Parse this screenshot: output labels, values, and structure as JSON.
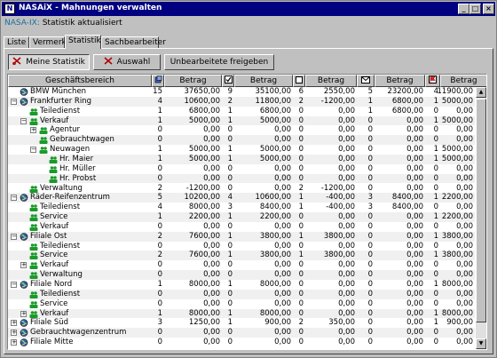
{
  "window": {
    "title": "NASAiX - Mahnungen verwalten",
    "app_icon": "nasaix-app-icon",
    "buttons": [
      "_",
      "□",
      "×"
    ]
  },
  "status": {
    "prefix": "NASA-IX:",
    "text": "Statistik aktualisiert"
  },
  "tabs": [
    "Liste",
    "Vermerk",
    "Statistik",
    "Sachbearbeiter"
  ],
  "active_tab": "Statistik",
  "toolbar": {
    "my_stats": "Meine Statistik",
    "selection": "Auswahl",
    "release": "Unbearbeitete freigeben"
  },
  "columns": {
    "area": "Geschäftsbereich",
    "amount": "Betrag",
    "icons": [
      "coins-icon",
      "checkbox-checked-icon",
      "checkbox-empty-icon",
      "envelope-icon",
      "red-flag-icon"
    ]
  },
  "rows": [
    {
      "label": "BMW München",
      "icon": "globe-icon",
      "level": 0,
      "exp": "",
      "v": [
        "15",
        "37650,00",
        "9",
        "35100,00",
        "6",
        "2550,00",
        "5",
        "23200,00",
        "4",
        "11900,00"
      ]
    },
    {
      "label": "Frankfurter Ring",
      "icon": "globe-icon",
      "level": 0,
      "exp": "−",
      "v": [
        "4",
        "10600,00",
        "2",
        "11800,00",
        "2",
        "-1200,00",
        "1",
        "6800,00",
        "1",
        "5000,00"
      ]
    },
    {
      "label": "Teiledienst",
      "icon": "people-icon",
      "level": 1,
      "exp": "",
      "v": [
        "1",
        "6800,00",
        "1",
        "6800,00",
        "0",
        "0,00",
        "1",
        "6800,00",
        "0",
        "0,00"
      ]
    },
    {
      "label": "Verkauf",
      "icon": "people-icon",
      "level": 1,
      "exp": "−",
      "v": [
        "1",
        "5000,00",
        "1",
        "5000,00",
        "0",
        "0,00",
        "0",
        "0,00",
        "1",
        "5000,00"
      ]
    },
    {
      "label": "Agentur",
      "icon": "people-icon",
      "level": 2,
      "exp": "+",
      "v": [
        "0",
        "0,00",
        "0",
        "0,00",
        "0",
        "0,00",
        "0",
        "0,00",
        "0",
        "0,00"
      ]
    },
    {
      "label": "Gebrauchtwagen",
      "icon": "people-icon",
      "level": 2,
      "exp": "",
      "v": [
        "0",
        "0,00",
        "0",
        "0,00",
        "0",
        "0,00",
        "0",
        "0,00",
        "0",
        "0,00"
      ]
    },
    {
      "label": "Neuwagen",
      "icon": "people-icon",
      "level": 2,
      "exp": "−",
      "v": [
        "1",
        "5000,00",
        "1",
        "5000,00",
        "0",
        "0,00",
        "0",
        "0,00",
        "1",
        "5000,00"
      ]
    },
    {
      "label": "Hr. Maier",
      "icon": "people-icon",
      "level": 3,
      "exp": "",
      "v": [
        "1",
        "5000,00",
        "1",
        "5000,00",
        "0",
        "0,00",
        "0",
        "0,00",
        "1",
        "5000,00"
      ]
    },
    {
      "label": "Hr. Müller",
      "icon": "people-icon",
      "level": 3,
      "exp": "",
      "v": [
        "0",
        "0,00",
        "0",
        "0,00",
        "0",
        "0,00",
        "0",
        "0,00",
        "0",
        "0,00"
      ]
    },
    {
      "label": "Hr. Probst",
      "icon": "people-icon",
      "level": 3,
      "exp": "",
      "v": [
        "0",
        "0,00",
        "0",
        "0,00",
        "0",
        "0,00",
        "0",
        "0,00",
        "0",
        "0,00"
      ]
    },
    {
      "label": "Verwaltung",
      "icon": "people-icon",
      "level": 1,
      "exp": "",
      "v": [
        "2",
        "-1200,00",
        "0",
        "0,00",
        "2",
        "-1200,00",
        "0",
        "0,00",
        "0",
        "0,00"
      ]
    },
    {
      "label": "Räder-Reifenzentrum",
      "icon": "globe-icon",
      "level": 0,
      "exp": "−",
      "v": [
        "5",
        "10200,00",
        "4",
        "10600,00",
        "1",
        "-400,00",
        "3",
        "8400,00",
        "1",
        "2200,00"
      ]
    },
    {
      "label": "Teiledienst",
      "icon": "people-icon",
      "level": 1,
      "exp": "",
      "v": [
        "4",
        "8000,00",
        "3",
        "8400,00",
        "1",
        "-400,00",
        "3",
        "8400,00",
        "0",
        "0,00"
      ]
    },
    {
      "label": "Service",
      "icon": "people-icon",
      "level": 1,
      "exp": "",
      "v": [
        "1",
        "2200,00",
        "1",
        "2200,00",
        "0",
        "0,00",
        "0",
        "0,00",
        "1",
        "2200,00"
      ]
    },
    {
      "label": "Verkauf",
      "icon": "people-icon",
      "level": 1,
      "exp": "",
      "v": [
        "0",
        "0,00",
        "0",
        "0,00",
        "0",
        "0,00",
        "0",
        "0,00",
        "0",
        "0,00"
      ]
    },
    {
      "label": "Filiale Ost",
      "icon": "globe-icon",
      "level": 0,
      "exp": "−",
      "v": [
        "2",
        "7600,00",
        "1",
        "3800,00",
        "1",
        "3800,00",
        "0",
        "0,00",
        "1",
        "3800,00"
      ]
    },
    {
      "label": "Teiledienst",
      "icon": "people-icon",
      "level": 1,
      "exp": "",
      "v": [
        "0",
        "0,00",
        "0",
        "0,00",
        "0",
        "0,00",
        "0",
        "0,00",
        "0",
        "0,00"
      ]
    },
    {
      "label": "Service",
      "icon": "people-icon",
      "level": 1,
      "exp": "",
      "v": [
        "2",
        "7600,00",
        "1",
        "3800,00",
        "1",
        "3800,00",
        "0",
        "0,00",
        "1",
        "3800,00"
      ]
    },
    {
      "label": "Verkauf",
      "icon": "people-icon",
      "level": 1,
      "exp": "+",
      "v": [
        "0",
        "0,00",
        "0",
        "0,00",
        "0",
        "0,00",
        "0",
        "0,00",
        "0",
        "0,00"
      ]
    },
    {
      "label": "Verwaltung",
      "icon": "people-icon",
      "level": 1,
      "exp": "",
      "v": [
        "0",
        "0,00",
        "0",
        "0,00",
        "0",
        "0,00",
        "0",
        "0,00",
        "0",
        "0,00"
      ]
    },
    {
      "label": "Filiale Nord",
      "icon": "globe-icon",
      "level": 0,
      "exp": "−",
      "v": [
        "1",
        "8000,00",
        "1",
        "8000,00",
        "0",
        "0,00",
        "0",
        "0,00",
        "1",
        "8000,00"
      ]
    },
    {
      "label": "Teiledienst",
      "icon": "people-icon",
      "level": 1,
      "exp": "",
      "v": [
        "0",
        "0,00",
        "0",
        "0,00",
        "0",
        "0,00",
        "0",
        "0,00",
        "0",
        "0,00"
      ]
    },
    {
      "label": "Service",
      "icon": "people-icon",
      "level": 1,
      "exp": "",
      "v": [
        "0",
        "0,00",
        "0",
        "0,00",
        "0",
        "0,00",
        "0",
        "0,00",
        "0",
        "0,00"
      ]
    },
    {
      "label": "Verkauf",
      "icon": "people-icon",
      "level": 1,
      "exp": "+",
      "v": [
        "1",
        "8000,00",
        "1",
        "8000,00",
        "0",
        "0,00",
        "0",
        "0,00",
        "1",
        "8000,00"
      ]
    },
    {
      "label": "Filiale Süd",
      "icon": "globe-icon",
      "level": 0,
      "exp": "+",
      "v": [
        "3",
        "1250,00",
        "1",
        "900,00",
        "2",
        "350,00",
        "0",
        "0,00",
        "1",
        "900,00"
      ]
    },
    {
      "label": "Gebrauchtwagenzentrum",
      "icon": "globe-icon",
      "level": 0,
      "exp": "+",
      "v": [
        "0",
        "0,00",
        "0",
        "0,00",
        "0",
        "0,00",
        "0",
        "0,00",
        "0",
        "0,00"
      ]
    },
    {
      "label": "Filiale Mitte",
      "icon": "globe-icon",
      "level": 0,
      "exp": "+",
      "v": [
        "0",
        "0,00",
        "0",
        "0,00",
        "0",
        "0,00",
        "0",
        "0,00",
        "0",
        "0,00"
      ]
    }
  ],
  "colors": {
    "title_bar": "#000080",
    "status_prefix": "#1a6ea0",
    "tree_icon_green": "#1a9a2a",
    "alt_row": "#f0f0f0"
  }
}
